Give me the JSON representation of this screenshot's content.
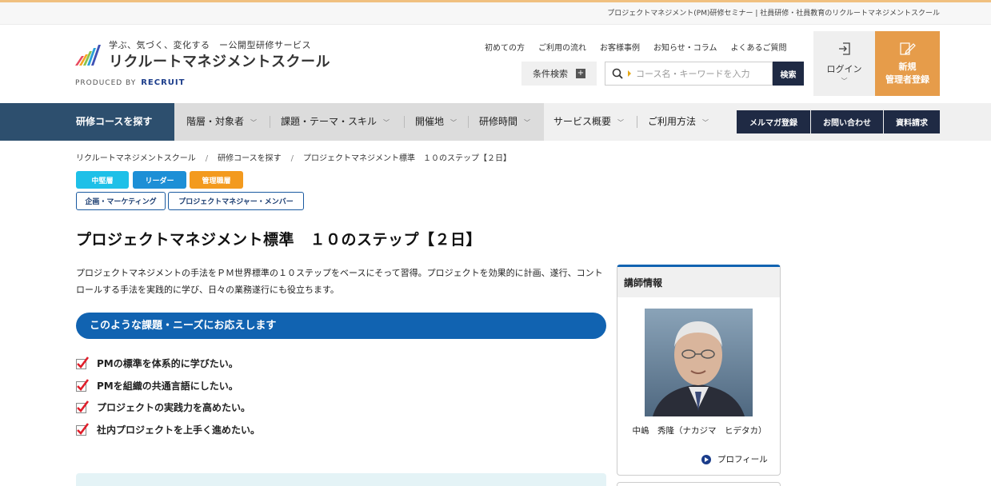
{
  "topbar": {
    "text": "プロジェクトマネジメント(PM)研修セミナー | 社員研修・社員教育のリクルートマネジメントスクール"
  },
  "logo": {
    "tagline": "学ぶ、気づく、変化する　ー公開型研修サービス",
    "name": "リクルートマネジメントスクール",
    "produced_by": "PRODUCED BY",
    "brand": "RECRUIT"
  },
  "utilnav": [
    "初めての方",
    "ご利用の流れ",
    "お客様事例",
    "お知らせ・コラム",
    "よくあるご質問"
  ],
  "search": {
    "cond_label": "条件検索",
    "placeholder": "コース名・キーワードを入力",
    "button": "検索"
  },
  "login": {
    "label": "ログイン"
  },
  "register": {
    "line1": "新規",
    "line2": "管理者登録"
  },
  "mainnav": {
    "first": "研修コースを探す",
    "items": [
      "階層・対象者",
      "課題・テーマ・スキル",
      "開催地",
      "研修時間",
      "サービス概要",
      "ご利用方法"
    ],
    "buttons": [
      "メルマガ登録",
      "お問い合わせ",
      "資料請求"
    ]
  },
  "breadcrumb": [
    "リクルートマネジメントスクール",
    "研修コースを探す",
    "プロジェクトマネジメント標準　１０のステップ【２日】"
  ],
  "tags_level": [
    {
      "label": "中堅層",
      "color": "#1ec0e8"
    },
    {
      "label": "リーダー",
      "color": "#1d8fd6"
    },
    {
      "label": "管理職層",
      "color": "#f39a1e"
    }
  ],
  "tags_theme": [
    "企画・マーケティング",
    "プロジェクトマネジャー・メンバー"
  ],
  "page_title": "プロジェクトマネジメント標準　１０のステップ【２日】",
  "lead": "プロジェクトマネジメントの手法をＰＭ世界標準の１０ステップをベースにそって習得。プロジェクトを効果的に計画、遂行、コントロールする手法を実践的に学び、日々の業務遂行にも役立ちます。",
  "section": {
    "heading": "このような課題・ニーズにお応えします",
    "checks": [
      "PMの標準を体系的に学びたい。",
      "PMを組織の共通言語にしたい。",
      "プロジェクトの実践力を高めたい。",
      "社内プロジェクトを上手く進めたい。"
    ]
  },
  "instructor": {
    "heading": "講師情報",
    "name": "中嶋　秀隆（ナカジマ　ヒデタカ）",
    "profile_link": "プロフィール"
  }
}
